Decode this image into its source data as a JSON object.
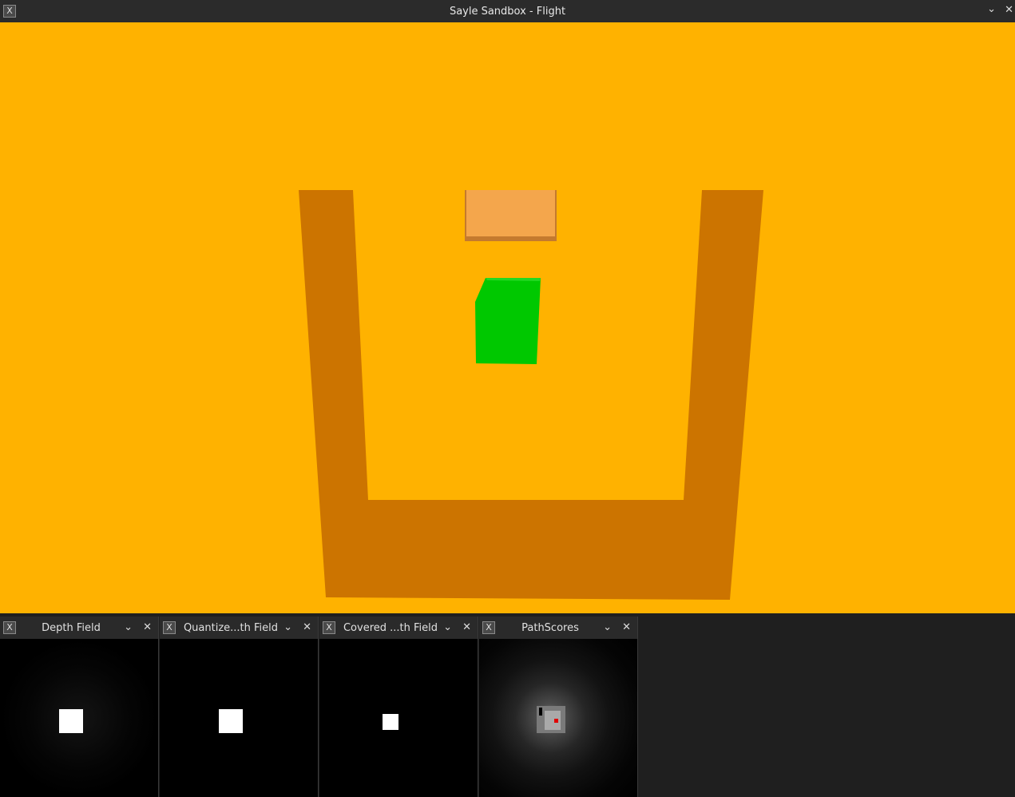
{
  "window": {
    "title": "Sayle Sandbox - Flight",
    "icon": "x-app-icon",
    "minimize_glyph": "⌄",
    "close_glyph": "✕"
  },
  "scene": {
    "background_color": "#ffb200",
    "walls_color": "#cc7400",
    "block_color": "#f4a64c",
    "cube_color": "#00c800"
  },
  "panels": [
    {
      "title": "Depth Field",
      "icon": "x-app-icon"
    },
    {
      "title": "Quantize...th Field",
      "icon": "x-app-icon"
    },
    {
      "title": "Covered ...th Field",
      "icon": "x-app-icon"
    },
    {
      "title": "PathScores",
      "icon": "x-app-icon"
    }
  ],
  "panel_controls": {
    "dropdown_glyph": "⌄",
    "close_glyph": "✕"
  }
}
